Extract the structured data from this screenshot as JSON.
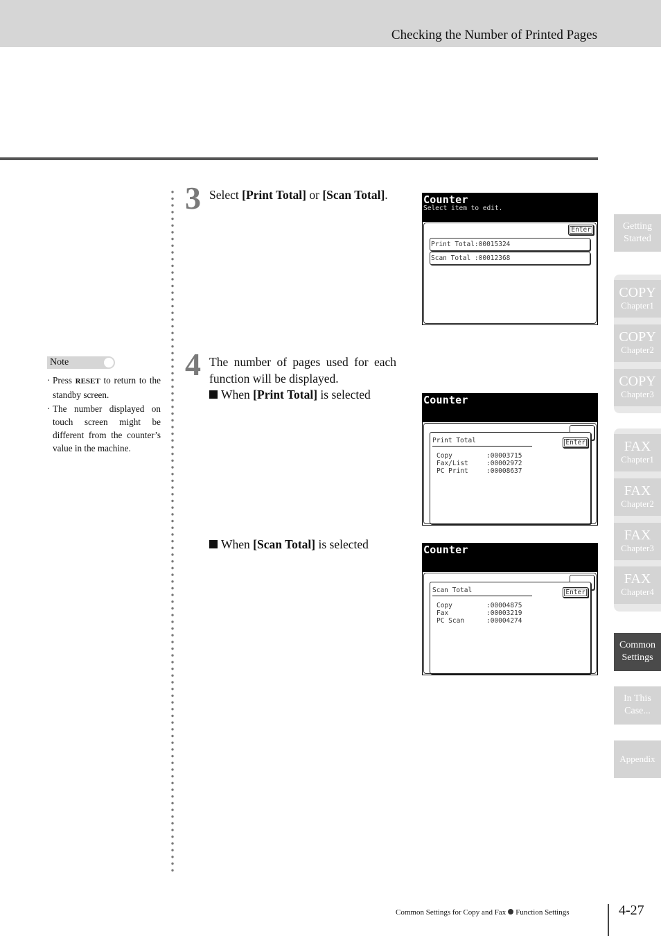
{
  "header": {
    "title": "Checking the Number of Printed Pages"
  },
  "step3": {
    "number": "3",
    "text_parts": [
      "Select ",
      "[Print Total]",
      " or ",
      "[Scan Total]",
      "."
    ]
  },
  "step4": {
    "number": "4",
    "text": "The number of pages used for each function will be displayed.",
    "sub1_parts": [
      "When ",
      "[Print Total]",
      " is selected"
    ],
    "sub2_parts": [
      "When ",
      "[Scan Total]",
      " is selected"
    ]
  },
  "note": {
    "label": "Note",
    "items": [
      {
        "pre": "Press ",
        "bold": "RESET",
        "post": " to return to the standby screen."
      },
      {
        "pre": "The number displayed on touch screen might be different from the counter’s value in the machine.",
        "bold": "",
        "post": ""
      }
    ]
  },
  "screen1": {
    "title": "Counter",
    "subtitle": "Select item to edit.",
    "enter_label": "Enter",
    "items": [
      "Print Total:00015324",
      "Scan Total :00012368"
    ]
  },
  "screen2": {
    "title": "Counter",
    "popup_title": "Print Total",
    "enter_label": "Enter",
    "rows": [
      {
        "label": "Copy",
        "value": ":00003715"
      },
      {
        "label": "Fax/List",
        "value": ":00002972"
      },
      {
        "label": "PC Print",
        "value": ":00008637"
      }
    ]
  },
  "screen3": {
    "title": "Counter",
    "popup_title": "Scan Total",
    "enter_label": "Enter",
    "rows": [
      {
        "label": "Copy",
        "value": ":00004875"
      },
      {
        "label": "Fax",
        "value": ":00003219"
      },
      {
        "label": "PC Scan",
        "value": ":00004274"
      }
    ]
  },
  "side_tabs": [
    {
      "line1": "Getting",
      "line2": "Started",
      "active": false
    },
    {
      "line1": "COPY",
      "line2": "Chapter1",
      "active": false
    },
    {
      "line1": "COPY",
      "line2": "Chapter2",
      "active": false
    },
    {
      "line1": "COPY",
      "line2": "Chapter3",
      "active": false
    },
    {
      "line1": "FAX",
      "line2": "Chapter1",
      "active": false
    },
    {
      "line1": "FAX",
      "line2": "Chapter2",
      "active": false
    },
    {
      "line1": "FAX",
      "line2": "Chapter3",
      "active": false
    },
    {
      "line1": "FAX",
      "line2": "Chapter4",
      "active": false
    },
    {
      "line1": "Common",
      "line2": "Settings",
      "active": true
    },
    {
      "line1": "In This",
      "line2": "Case...",
      "active": false
    },
    {
      "line1": "Appendix",
      "line2": "",
      "active": false
    }
  ],
  "footer": {
    "left": "Common Settings for Copy and Fax",
    "right": "Function Settings",
    "page": "4-27"
  },
  "colors": {
    "header_band": "#d6d6d6",
    "tab_inactive": "#d4d4d4",
    "tab_active": "#4a4a4a",
    "step_number": "#7a7a7a"
  }
}
